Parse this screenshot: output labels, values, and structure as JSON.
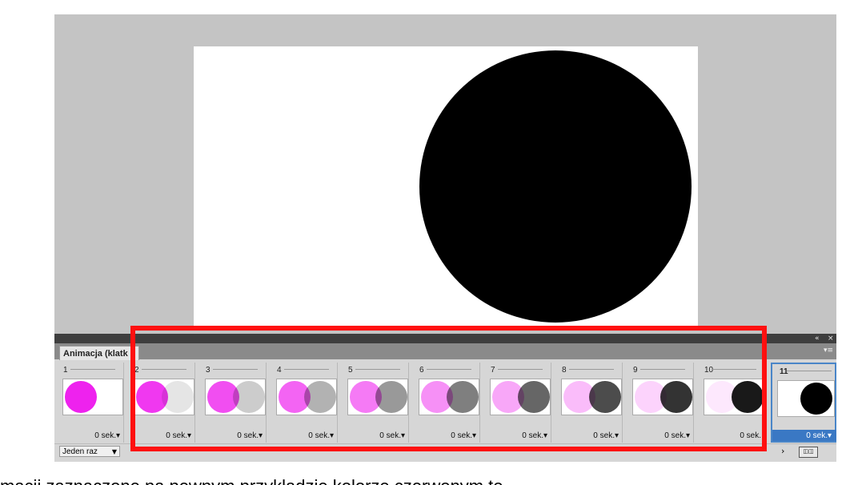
{
  "colors": {
    "workspace": "#c4c4c4",
    "magenta": "#ee22ee",
    "highlight": "#ff1010",
    "selection": "#3a78c4"
  },
  "panel": {
    "tab_label": "Animacja (klatk",
    "collapse_icon": "double-chevron-left-icon",
    "close_icon": "close-icon",
    "menu_icon": "panel-menu-icon",
    "loop_value": "Jeden raz"
  },
  "frames": [
    {
      "num": "1",
      "delay": "0 sek.▾",
      "magenta_opacity": 1.0,
      "black_opacity": 0.0
    },
    {
      "num": "2",
      "delay": "0 sek.▾",
      "magenta_opacity": 0.9,
      "black_opacity": 0.1
    },
    {
      "num": "3",
      "delay": "0 sek.▾",
      "magenta_opacity": 0.8,
      "black_opacity": 0.2
    },
    {
      "num": "4",
      "delay": "0 sek.▾",
      "magenta_opacity": 0.7,
      "black_opacity": 0.3
    },
    {
      "num": "5",
      "delay": "0 sek.▾",
      "magenta_opacity": 0.6,
      "black_opacity": 0.4
    },
    {
      "num": "6",
      "delay": "0 sek.▾",
      "magenta_opacity": 0.5,
      "black_opacity": 0.5
    },
    {
      "num": "7",
      "delay": "0 sek.▾",
      "magenta_opacity": 0.4,
      "black_opacity": 0.6
    },
    {
      "num": "8",
      "delay": "0 sek.▾",
      "magenta_opacity": 0.3,
      "black_opacity": 0.7
    },
    {
      "num": "9",
      "delay": "0 sek.▾",
      "magenta_opacity": 0.2,
      "black_opacity": 0.8
    },
    {
      "num": "10",
      "delay": "0 sek.",
      "magenta_opacity": 0.1,
      "black_opacity": 0.9
    },
    {
      "num": "11",
      "delay": "0 sek.▾",
      "magenta_opacity": 0.0,
      "black_opacity": 1.0,
      "selected": true
    }
  ],
  "caption": "macji zaznaczone na pewnym przykładzie kolorze czerwonym to"
}
